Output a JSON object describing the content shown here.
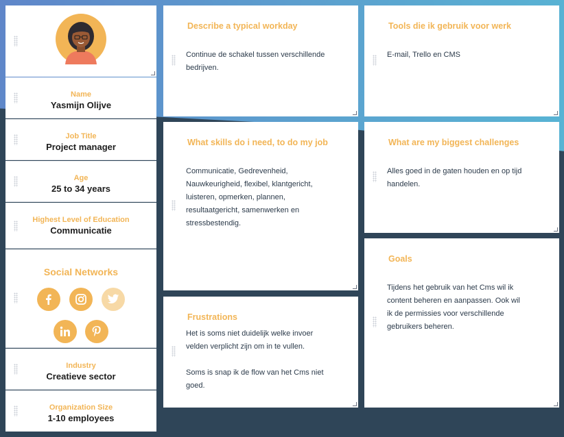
{
  "persona": {
    "fields": [
      {
        "label": "Name",
        "value": "Yasmijn Olijve"
      },
      {
        "label": "Job Title",
        "value": "Project manager"
      },
      {
        "label": "Age",
        "value": "25 to 34 years"
      },
      {
        "label": "Highest Level of Education",
        "value": "Communicatie"
      }
    ],
    "social_title": "Social Networks",
    "social_icons": [
      "facebook-icon",
      "instagram-icon",
      "twitter-icon",
      "linkedin-icon",
      "pinterest-icon"
    ],
    "industry": {
      "label": "Industry",
      "value": "Creatieve sector"
    },
    "org_size": {
      "label": "Organization Size",
      "value": "1-10 employees"
    }
  },
  "cards": {
    "workday": {
      "title": "Describe a typical workday",
      "body": "Continue de schakel tussen verschillende\nbedrijven."
    },
    "tools": {
      "title": "Tools die ik gebruik voor werk",
      "body": "E-mail, Trello en CMS"
    },
    "skills": {
      "title": "What skills do i need, to do my job",
      "body": "Communicatie, Gedrevenheid,\nNauwkeurigheid, flexibel,  klantgericht,\nluisteren, opmerken, plannen,\nresultaatgericht,  samenwerken en\nstressbestendig."
    },
    "challenges": {
      "title": "What are my biggest challenges",
      "body": "Alles goed in de gaten houden en op tijd\nhandelen."
    },
    "frustrations": {
      "title": "Frustrations",
      "body": "Het is soms niet duidelijk welke invoer\nvelden verplicht zijn om in te vullen.\n\nSoms is snap ik de flow van het Cms niet\ngoed."
    },
    "goals": {
      "title": "Goals",
      "body": "Tijdens het gebruik van het Cms wil ik\ncontent beheren en aanpassen. Ook wil\nik de permissies voor verschillende\ngebruikers beheren."
    }
  },
  "colors": {
    "accent": "#f2b556",
    "text": "#2b3a4a",
    "bg_dark": "#2f4558",
    "bg_top": "#5ba3cf"
  }
}
